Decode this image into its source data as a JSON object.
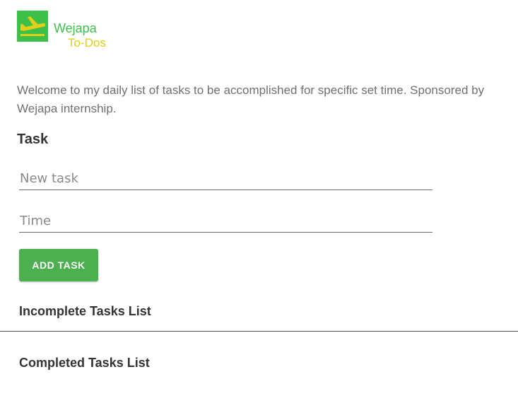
{
  "brand": {
    "name": "Wejapa",
    "subtitle": "To-Dos",
    "logo_icon": "airplane-takeoff-icon",
    "colors": {
      "green": "#3dbf4a",
      "yellow": "#e1cf1a"
    }
  },
  "intro": "Welcome to my daily list of tasks to be accomplished for specific set time. Sponsored by Wejapa internship.",
  "form": {
    "title": "Task",
    "task_input": {
      "value": "",
      "placeholder": "New task"
    },
    "time_input": {
      "value": "",
      "placeholder": "Time"
    },
    "add_button_label": "ADD TASK",
    "button_color": "#4caf50"
  },
  "lists": {
    "incomplete": {
      "title": "Incomplete Tasks List",
      "items": []
    },
    "completed": {
      "title": "Completed Tasks List",
      "items": []
    }
  }
}
